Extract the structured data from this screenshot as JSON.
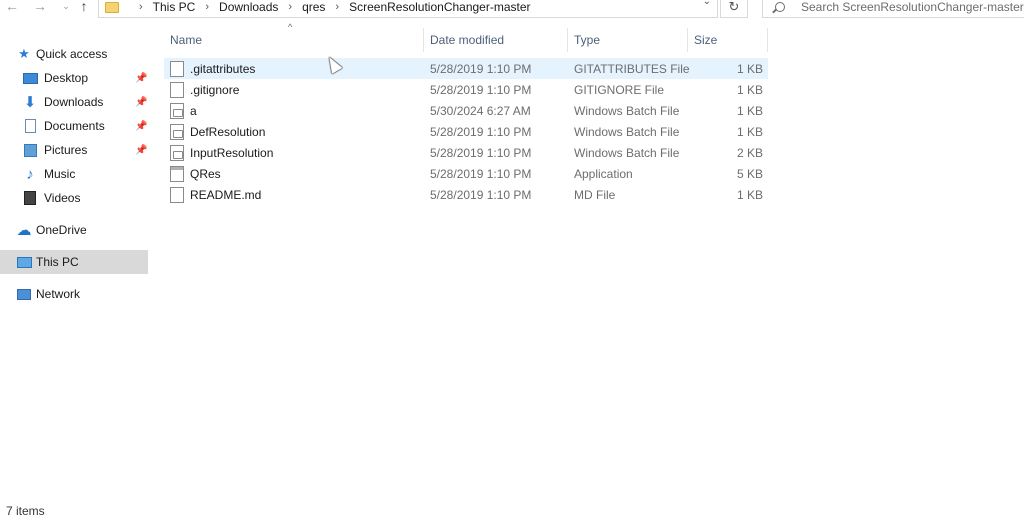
{
  "address_bar": {
    "crumbs": [
      "This PC",
      "Downloads",
      "qres",
      "ScreenResolutionChanger-master"
    ]
  },
  "search": {
    "placeholder": "Search ScreenResolutionChanger-master"
  },
  "sidebar": {
    "items": [
      {
        "label": "Quick access",
        "icon": "star-icon"
      },
      {
        "label": "Desktop",
        "icon": "desktop-icon",
        "pinned": true
      },
      {
        "label": "Downloads",
        "icon": "download-icon",
        "pinned": true
      },
      {
        "label": "Documents",
        "icon": "documents-icon",
        "pinned": true
      },
      {
        "label": "Pictures",
        "icon": "pictures-icon",
        "pinned": true
      },
      {
        "label": "Music",
        "icon": "music-icon"
      },
      {
        "label": "Videos",
        "icon": "videos-icon"
      },
      {
        "label": "OneDrive",
        "icon": "cloud-icon"
      },
      {
        "label": "This PC",
        "icon": "computer-icon",
        "selected": true
      },
      {
        "label": "Network",
        "icon": "network-icon"
      }
    ]
  },
  "columns": {
    "name": "Name",
    "date": "Date modified",
    "type": "Type",
    "size": "Size"
  },
  "files": [
    {
      "name": ".gitattributes",
      "date": "5/28/2019 1:10 PM",
      "type": "GITATTRIBUTES File",
      "size": "1 KB",
      "icon": "file-icon"
    },
    {
      "name": ".gitignore",
      "date": "5/28/2019 1:10 PM",
      "type": "GITIGNORE File",
      "size": "1 KB",
      "icon": "file-icon"
    },
    {
      "name": "a",
      "date": "5/30/2024 6:27 AM",
      "type": "Windows Batch File",
      "size": "1 KB",
      "icon": "batch-file-icon"
    },
    {
      "name": "DefResolution",
      "date": "5/28/2019 1:10 PM",
      "type": "Windows Batch File",
      "size": "1 KB",
      "icon": "batch-file-icon"
    },
    {
      "name": "InputResolution",
      "date": "5/28/2019 1:10 PM",
      "type": "Windows Batch File",
      "size": "2 KB",
      "icon": "batch-file-icon"
    },
    {
      "name": "QRes",
      "date": "5/28/2019 1:10 PM",
      "type": "Application",
      "size": "5 KB",
      "icon": "application-icon"
    },
    {
      "name": "README.md",
      "date": "5/28/2019 1:10 PM",
      "type": "MD File",
      "size": "1 KB",
      "icon": "file-icon"
    }
  ],
  "status": {
    "item_count": "7 items"
  }
}
